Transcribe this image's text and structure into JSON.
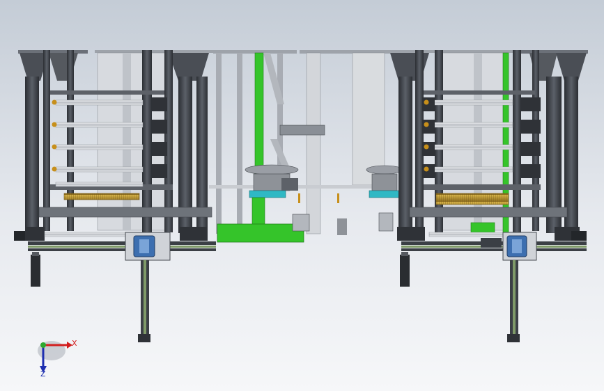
{
  "view": {
    "background_top": "#c4ccd6",
    "background_bottom": "#f6f7f9",
    "description_colors": {
      "frame_dark": "#3c3f44",
      "frame_mid": "#8a8f96",
      "frame_light": "#c9ccd1",
      "accent_green": "#35c42a",
      "accent_cyan": "#2fb8c4",
      "motor_blue": "#3d6fb0",
      "brush_gold": "#b8952f"
    }
  },
  "triad": {
    "x_label": "X",
    "z_label": "Z",
    "x_color": "#d21e1e",
    "y_color": "#2fa82f",
    "z_color": "#1e2fb0"
  },
  "assembly": {
    "left_unit": {
      "icon": "machine-frame-left"
    },
    "center_unit": {
      "icon": "machine-center-module"
    },
    "right_unit": {
      "icon": "machine-frame-right"
    }
  }
}
